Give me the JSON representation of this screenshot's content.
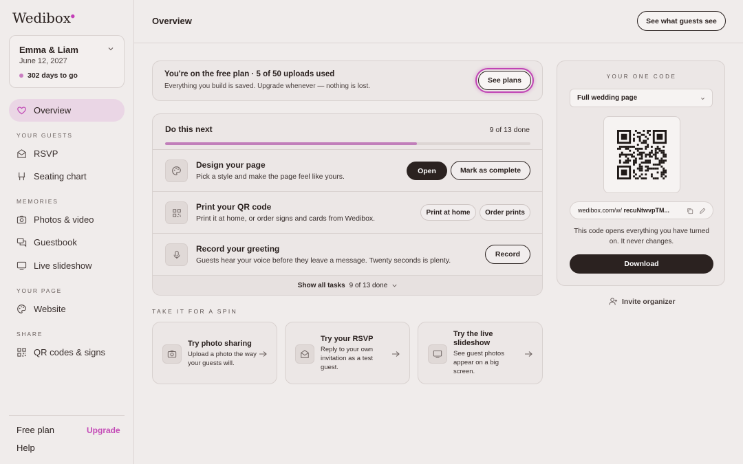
{
  "brand": {
    "logo": "Wedibox",
    "accent": "#c43fb8"
  },
  "event": {
    "name": "Emma & Liam",
    "date": "June 12, 2027",
    "countdown": "302 days to go"
  },
  "nav": {
    "active": "Overview",
    "sections": [
      {
        "label": "YOUR GUESTS",
        "items": [
          "RSVP",
          "Seating chart"
        ]
      },
      {
        "label": "MEMORIES",
        "items": [
          "Photos & video",
          "Guestbook",
          "Live slideshow"
        ]
      },
      {
        "label": "YOUR PAGE",
        "items": [
          "Website"
        ]
      },
      {
        "label": "SHARE",
        "items": [
          "QR codes & signs"
        ]
      }
    ],
    "footer": {
      "plan": "Free plan",
      "upgrade": "Upgrade",
      "help": "Help"
    }
  },
  "header": {
    "title": "Overview",
    "guest_view_button": "See what guests see"
  },
  "banner": {
    "title": "You're on the free plan · 5 of 50 uploads used",
    "subtitle": "Everything you build is saved. Upgrade whenever — nothing is lost.",
    "button": "See plans"
  },
  "tasks": {
    "heading": "Do this next",
    "count": "9 of 13 done",
    "progress": 0.69,
    "rows": [
      {
        "title": "Design your page",
        "desc": "Pick a style and make the page feel like yours.",
        "primary": "Open",
        "secondary": "Mark as complete",
        "icon": "palette-icon"
      },
      {
        "title": "Print your QR code",
        "desc": "Print it at home, or order signs and cards from Wedibox.",
        "primary": "Print at home",
        "secondary": "Order prints",
        "icon": "qr-icon"
      },
      {
        "title": "Record your greeting",
        "desc": "Guests hear your voice before they leave a message. Twenty seconds is plenty.",
        "primary": "Record",
        "icon": "mic-icon"
      }
    ],
    "show_all": "Show all tasks",
    "show_all_count": "9 of 13 done"
  },
  "spin": {
    "label": "TAKE IT FOR A SPIN",
    "cards": [
      {
        "title": "Try photo sharing",
        "desc": "Upload a photo the way your guests will.",
        "icon": "camera-icon"
      },
      {
        "title": "Try your RSVP",
        "desc": "Reply to your own invitation as a test guest.",
        "icon": "envelope-icon"
      },
      {
        "title": "Try the live slideshow",
        "desc": "See guest photos appear on a big screen.",
        "icon": "monitor-icon"
      }
    ]
  },
  "code_panel": {
    "label": "YOUR ONE CODE",
    "select_value": "Full wedding page",
    "url_prefix": "wedibox.com/w/",
    "url_code": "recuNtwvpTM...",
    "help": "This code opens everything you have turned on. It never changes.",
    "download": "Download"
  },
  "invite": "Invite organizer"
}
